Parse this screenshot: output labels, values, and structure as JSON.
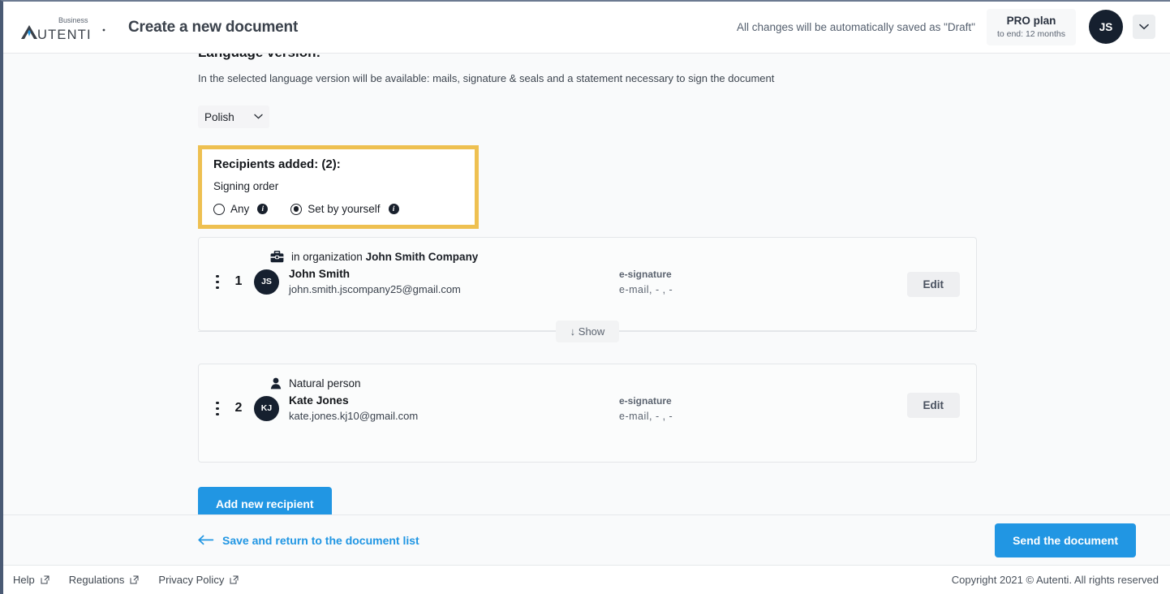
{
  "header": {
    "logo_text": "AUTENTI",
    "logo_superscript": "Business",
    "page_title": "Create a new document",
    "autosave_note": "All changes will be automatically saved as \"Draft\"",
    "plan_name": "PRO plan",
    "plan_sub": "to end: 12 months",
    "avatar_initials": "JS",
    "avatar_caret": "⌄"
  },
  "language_section": {
    "title": "Language version:",
    "description": "In the selected language version will be available: mails, signature & seals and a statement necessary to sign the document",
    "selected": "Polish",
    "caret": "⌄"
  },
  "recipients_panel": {
    "title": "Recipients added: (2):",
    "subtitle": "Signing order",
    "highlight_color": "#eec051",
    "options": [
      {
        "label": "Any",
        "checked": false,
        "info": "i"
      },
      {
        "label": "Set by yourself",
        "checked": true,
        "info": "i"
      }
    ]
  },
  "recipients": [
    {
      "seq": "1",
      "type_icon": "briefcase-icon",
      "type_prefix": "in organization ",
      "type_name": "John Smith Company",
      "initials": "JS",
      "name": "John Smith",
      "email": "john.smith.jscompany25@gmail.com",
      "signature_type": "e-signature",
      "signature_meta": "e-mail,  -  ,  -",
      "edit_label": "Edit"
    },
    {
      "seq": "2",
      "type_icon": "person-icon",
      "type_prefix": "",
      "type_name": "Natural person",
      "initials": "KJ",
      "name": "Kate Jones",
      "email": "kate.jones.kj10@gmail.com",
      "signature_type": "e-signature",
      "signature_meta": "e-mail,  -  ,  -",
      "edit_label": "Edit"
    }
  ],
  "show_button": {
    "label": "↓ Show"
  },
  "add_recipient_label": "Add new recipient",
  "action_bar": {
    "back_arrow": "←",
    "back_label": "Save and return to the document list",
    "send_label": "Send the document",
    "accent_color": "#2196e3"
  },
  "footer": {
    "links": [
      {
        "label": "Help"
      },
      {
        "label": "Regulations"
      },
      {
        "label": "Privacy Policy"
      }
    ],
    "copyright": "Copyright 2021 © Autenti. All rights reserved"
  }
}
